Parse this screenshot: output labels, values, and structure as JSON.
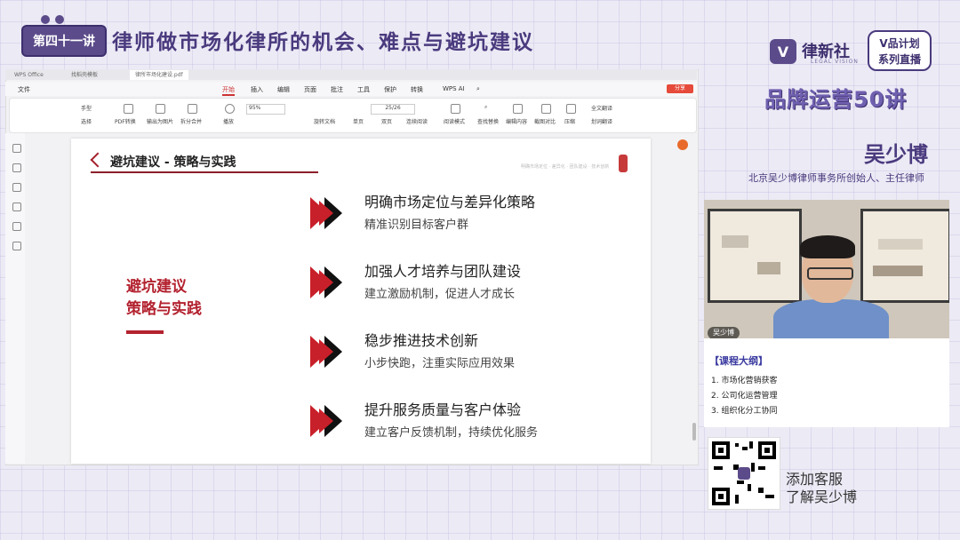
{
  "header": {
    "lesson_badge": "第四十一讲",
    "title": "律师做市场化律所的机会、难点与避坑建议"
  },
  "brand": {
    "logo_text": "律新社",
    "logo_sub": "LEGAL VISION",
    "tv_line1": "V品计划",
    "tv_line2": "系列直播",
    "series_title": "品牌运营50讲"
  },
  "speaker": {
    "name": "吴少博",
    "title": "北京吴少博律师事务所创始人、主任律师",
    "video_tag": "吴少博"
  },
  "outline": {
    "title": "【课程大纲】",
    "items": [
      "1. 市场化营销获客",
      "2. 公司化运营管理",
      "3. 组织化分工协同"
    ]
  },
  "qr": {
    "line1": "添加客服",
    "line2": "了解吴少博"
  },
  "app": {
    "tabs": [
      "WPS Office",
      "找稻壳模板",
      "律所市场化建设.pdf"
    ],
    "menu": [
      "文件",
      "开始",
      "插入",
      "编辑",
      "页面",
      "批注",
      "工具",
      "保护",
      "转换",
      "WPS AI"
    ],
    "share": "分享",
    "ribbon": {
      "hand": "手型",
      "select": "选择",
      "pdf_convert": "PDF转换",
      "export_image": "输出为图片",
      "split_merge": "拆分合并",
      "play": "播放",
      "zoom": "95%",
      "page": "25/26",
      "rotate": "旋转文档",
      "single": "单页",
      "double": "双页",
      "continuous": "连续阅读",
      "read_mode": "阅读模式",
      "find_replace": "查找替换",
      "edit_content": "编辑内容",
      "screenshot": "截图对比",
      "compress": "压缩",
      "fulltext_translate": "全文翻译",
      "word_translate": "划词翻译"
    }
  },
  "slide": {
    "title": "避坑建议 - 策略与实践",
    "faint": "明确市场定位 · 差异化 · 团队建设 · 技术创新",
    "left_heading_1": "避坑建议",
    "left_heading_2": "策略与实践",
    "points": [
      {
        "title": "明确市场定位与差异化策略",
        "sub": "精准识别目标客户群"
      },
      {
        "title": "加强人才培养与团队建设",
        "sub": "建立激励机制，促进人才成长"
      },
      {
        "title": "稳步推进技术创新",
        "sub": "小步快跑，注重实际应用效果"
      },
      {
        "title": "提升服务质量与客户体验",
        "sub": "建立客户反馈机制，持续优化服务"
      }
    ]
  },
  "colors": {
    "accent_purple": "#4a3a7e",
    "accent_red": "#b3222f"
  }
}
